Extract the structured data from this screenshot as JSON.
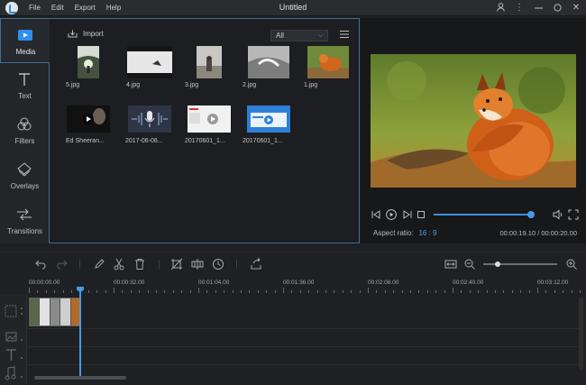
{
  "window": {
    "title": "Untitled",
    "menu": [
      "File",
      "Edit",
      "Export",
      "Help"
    ],
    "controls": [
      "user-icon",
      "more-icon",
      "minimize-icon",
      "maximize-icon",
      "close-icon"
    ]
  },
  "sidebar": {
    "tabs": [
      {
        "label": "Media",
        "icon": "media-icon",
        "active": true
      },
      {
        "label": "Text",
        "icon": "text-icon",
        "active": false
      },
      {
        "label": "Filters",
        "icon": "filters-icon",
        "active": false
      },
      {
        "label": "Overlays",
        "icon": "overlays-icon",
        "active": false
      },
      {
        "label": "Transitions",
        "icon": "transitions-icon",
        "active": false
      }
    ]
  },
  "media": {
    "import_label": "Import",
    "filter_value": "All",
    "items": [
      {
        "name": "5.jpg",
        "type": "image"
      },
      {
        "name": "4.jpg",
        "type": "image"
      },
      {
        "name": "3.jpg",
        "type": "image"
      },
      {
        "name": "2.jpg",
        "type": "image"
      },
      {
        "name": "1.jpg",
        "type": "image"
      },
      {
        "name": "Ed Sheeran...",
        "type": "video"
      },
      {
        "name": "2017-06-06...",
        "type": "audio"
      },
      {
        "name": "20170601_1...",
        "type": "video"
      },
      {
        "name": "20170601_1...",
        "type": "video"
      }
    ]
  },
  "preview": {
    "aspect_label": "Aspect ratio:",
    "aspect_value": "16 : 9",
    "timecode": "00:00:19.10 / 00:00:20.00",
    "progress": 0.96
  },
  "timeline": {
    "ticks": [
      "00:00:00.00",
      "00:00:32.00",
      "00:01:04.00",
      "00:01:36.00",
      "00:02:08.00",
      "00:02:40.00",
      "00:03:12.00"
    ],
    "zoom_level": 0.2
  },
  "colors": {
    "accent": "#4a9ae6",
    "panel_border": "#3d6f97",
    "background": "#1e2023"
  }
}
